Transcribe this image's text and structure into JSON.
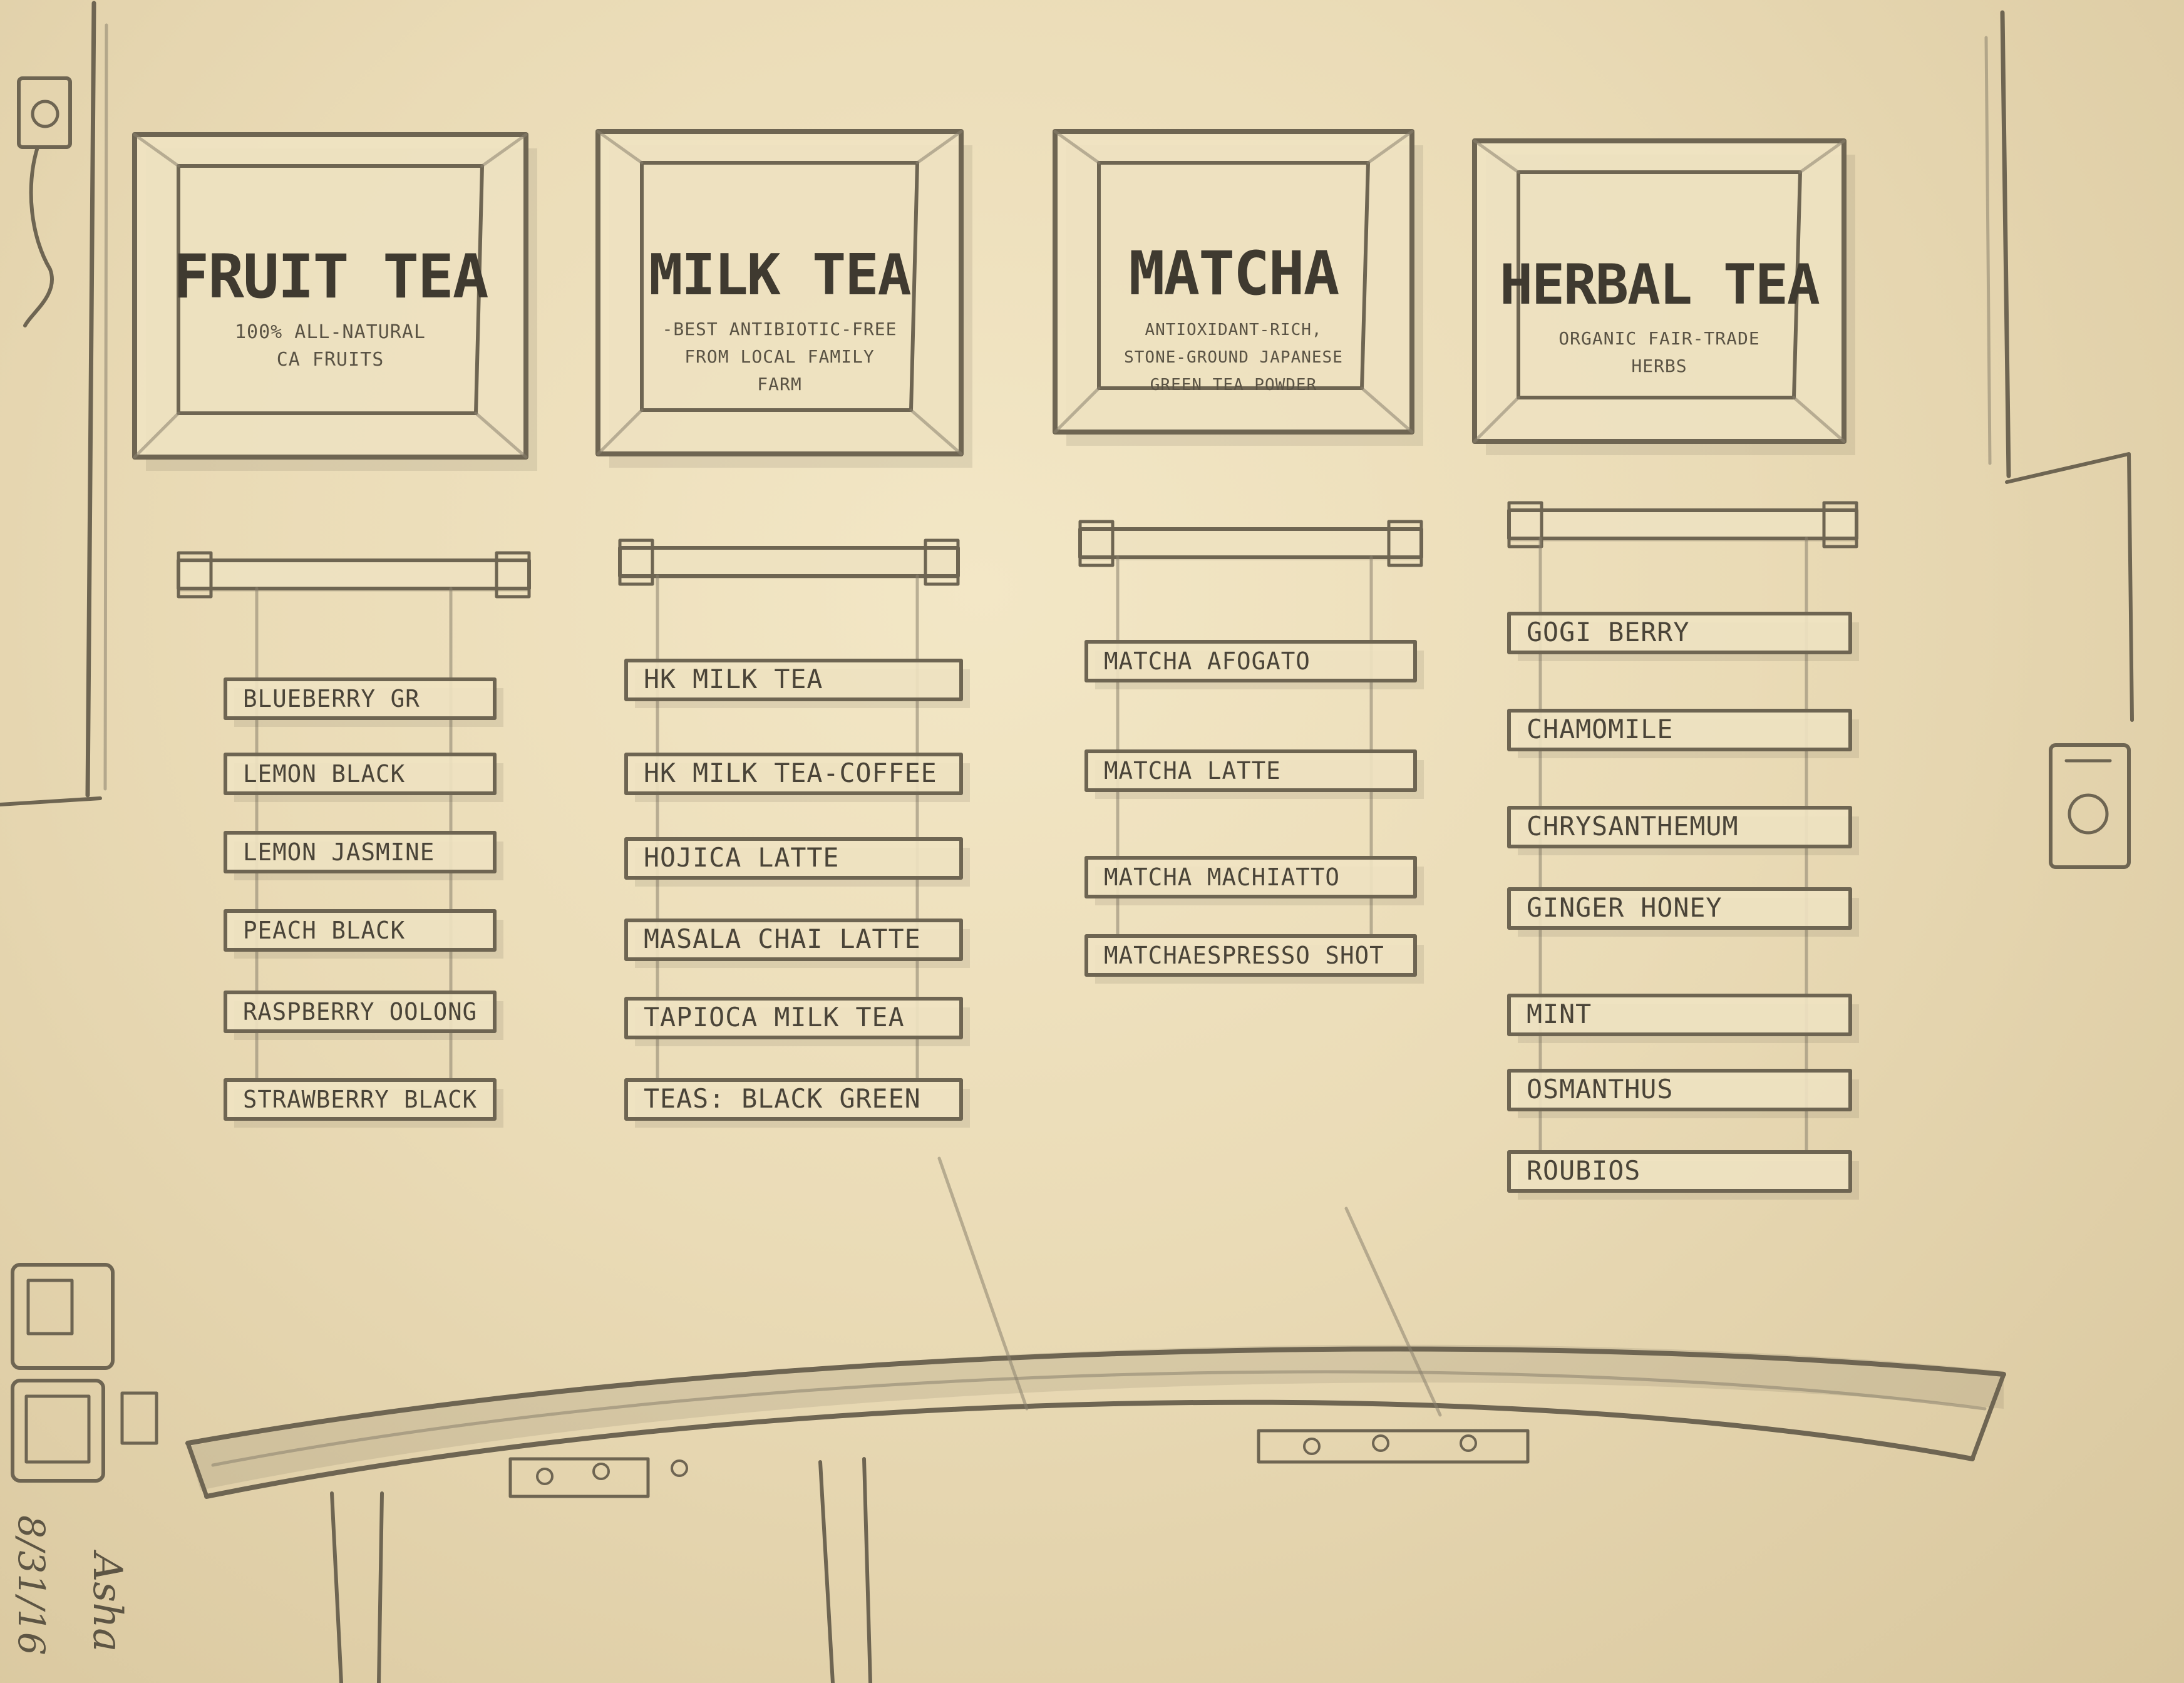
{
  "frames": [
    {
      "title": "FRUIT TEA",
      "subtitle_lines": [
        "100% ALL-NATURAL",
        "CA FRUITS"
      ]
    },
    {
      "title": "MILK TEA",
      "subtitle_lines": [
        "-BEST ANTIBIOTIC-FREE",
        "FROM LOCAL FAMILY",
        "FARM"
      ]
    },
    {
      "title": "MATCHA",
      "subtitle_lines": [
        "ANTIOXIDANT-RICH,",
        "STONE-GROUND JAPANESE",
        "GREEN TEA POWDER"
      ]
    },
    {
      "title": "HERBAL TEA",
      "subtitle_lines": [
        "ORGANIC FAIR-TRADE",
        "HERBS"
      ]
    }
  ],
  "menus": [
    {
      "items": [
        "BLUEBERRY GR",
        "LEMON BLACK",
        "LEMON JASMINE",
        "PEACH BLACK",
        "RASPBERRY OOLONG",
        "STRAWBERRY BLACK"
      ]
    },
    {
      "items": [
        "HK MILK TEA",
        "HK MILK TEA-COFFEE",
        "HOJICA LATTE",
        "MASALA CHAI LATTE",
        "TAPIOCA MILK TEA",
        "TEAS: BLACK GREEN"
      ]
    },
    {
      "items": [
        "MATCHA AFOGATO",
        "MATCHA LATTE",
        "MATCHA MACHIATTO",
        "MATCHAESPRESSO SHOT"
      ]
    },
    {
      "items": [
        "GOGI BERRY",
        "CHAMOMILE",
        "CHRYSANTHEMUM",
        "GINGER HONEY",
        "MINT",
        "OSMANTHUS",
        "ROUBIOS"
      ]
    }
  ],
  "signature": {
    "name": "Asha",
    "date": "8/31/16"
  }
}
